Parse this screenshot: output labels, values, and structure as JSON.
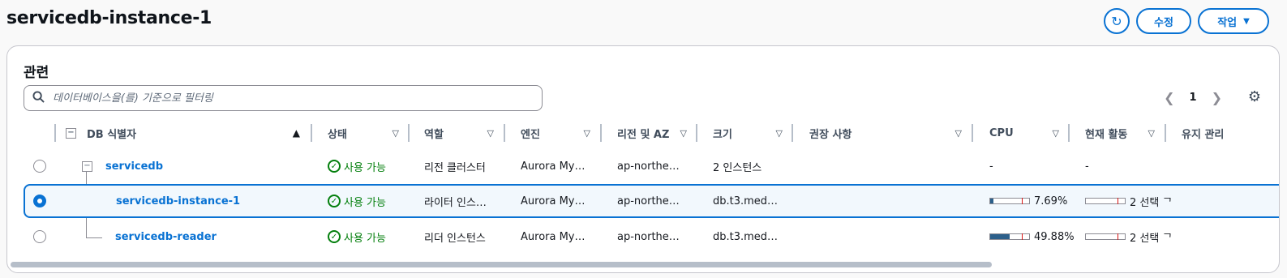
{
  "header": {
    "title": "servicedb-instance-1",
    "edit_label": "수정",
    "actions_label": "작업"
  },
  "related": {
    "title": "관련",
    "search_placeholder": "데이터베이스을(를) 기준으로 필터링",
    "page": "1",
    "columns": [
      "DB 식별자",
      "상태",
      "역할",
      "엔진",
      "리전 및 AZ",
      "크기",
      "권장 사항",
      "CPU",
      "현재 활동",
      "유지 관리"
    ],
    "rows": [
      {
        "id": "servicedb",
        "status": "사용 가능",
        "role": "리전 클러스터",
        "engine": "Aurora My…",
        "region": "ap-northe…",
        "size": "2 인스턴스",
        "recommendation": "",
        "cpu_text": "-",
        "activity_text": "-",
        "selected": false
      },
      {
        "id": "servicedb-instance-1",
        "status": "사용 가능",
        "role": "라이터 인스…",
        "engine": "Aurora My…",
        "region": "ap-northe…",
        "size": "db.t3.med…",
        "recommendation": "",
        "cpu_text": "7.69%",
        "cpu_pct": 7.69,
        "activity_text": "2 선택 ᄀ",
        "selected": true
      },
      {
        "id": "servicedb-reader",
        "status": "사용 가능",
        "role": "리더 인스턴스",
        "engine": "Aurora My…",
        "region": "ap-northe…",
        "size": "db.t3.med…",
        "recommendation": "",
        "cpu_text": "49.88%",
        "cpu_pct": 49.88,
        "activity_text": "2 선택 ᄀ",
        "selected": false
      }
    ]
  },
  "colors": {
    "accent": "#0972d3",
    "success": "#037f0c"
  }
}
